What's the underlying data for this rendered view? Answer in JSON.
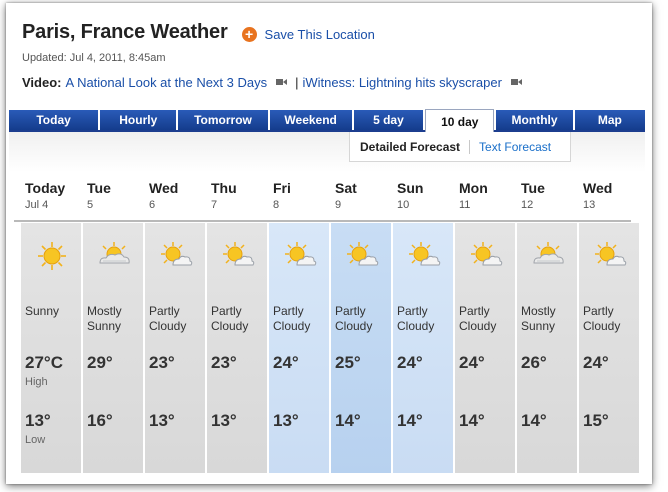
{
  "header": {
    "title": "Paris, France Weather",
    "save_label": "Save This Location",
    "updated": "Updated: Jul 4, 2011, 8:45am"
  },
  "video": {
    "label": "Video:",
    "link1": "A National Look at the Next 3 Days",
    "separator": "|",
    "link2": "iWitness: Lightning hits skyscraper"
  },
  "tabs": [
    "Today",
    "Hourly",
    "Tomorrow",
    "Weekend",
    "5 day",
    "10 day",
    "Monthly",
    "Map"
  ],
  "active_tab": "10 day",
  "forecast_switch": {
    "detailed": "Detailed Forecast",
    "text": "Text Forecast"
  },
  "days": [
    {
      "name": "Today",
      "date": "Jul 4",
      "condition_1": "Sunny",
      "condition_2": "",
      "icon": "sun-icon",
      "high": "27°C",
      "high_label": "High",
      "low": "13°",
      "low_label": "Low"
    },
    {
      "name": "Tue",
      "date": "5",
      "condition_1": "Mostly",
      "condition_2": "Sunny",
      "icon": "mostly-sunny-icon",
      "high": "29°",
      "high_label": "",
      "low": "16°",
      "low_label": ""
    },
    {
      "name": "Wed",
      "date": "6",
      "condition_1": "Partly",
      "condition_2": "Cloudy",
      "icon": "partly-cloudy-icon",
      "high": "23°",
      "high_label": "",
      "low": "13°",
      "low_label": ""
    },
    {
      "name": "Thu",
      "date": "7",
      "condition_1": "Partly",
      "condition_2": "Cloudy",
      "icon": "partly-cloudy-icon",
      "high": "23°",
      "high_label": "",
      "low": "13°",
      "low_label": ""
    },
    {
      "name": "Fri",
      "date": "8",
      "condition_1": "Partly",
      "condition_2": "Cloudy",
      "icon": "partly-cloudy-icon",
      "high": "24°",
      "high_label": "",
      "low": "13°",
      "low_label": ""
    },
    {
      "name": "Sat",
      "date": "9",
      "condition_1": "Partly",
      "condition_2": "Cloudy",
      "icon": "partly-cloudy-icon",
      "high": "25°",
      "high_label": "",
      "low": "14°",
      "low_label": ""
    },
    {
      "name": "Sun",
      "date": "10",
      "condition_1": "Partly",
      "condition_2": "Cloudy",
      "icon": "partly-cloudy-icon",
      "high": "24°",
      "high_label": "",
      "low": "14°",
      "low_label": ""
    },
    {
      "name": "Mon",
      "date": "11",
      "condition_1": "Partly",
      "condition_2": "Cloudy",
      "icon": "partly-cloudy-icon",
      "high": "24°",
      "high_label": "",
      "low": "14°",
      "low_label": ""
    },
    {
      "name": "Tue",
      "date": "12",
      "condition_1": "Mostly",
      "condition_2": "Sunny",
      "icon": "mostly-sunny-icon",
      "high": "26°",
      "high_label": "",
      "low": "14°",
      "low_label": ""
    },
    {
      "name": "Wed",
      "date": "13",
      "condition_1": "Partly",
      "condition_2": "Cloudy",
      "icon": "partly-cloudy-icon",
      "high": "24°",
      "high_label": "",
      "low": "15°",
      "low_label": ""
    }
  ],
  "colors": {
    "link": "#1a4fa8",
    "tab_blue": "#1c3d8f",
    "save_orange": "#e8731f",
    "weekend_blue": "#c9dcf3",
    "weekday_gray": "#dcdcdc"
  }
}
